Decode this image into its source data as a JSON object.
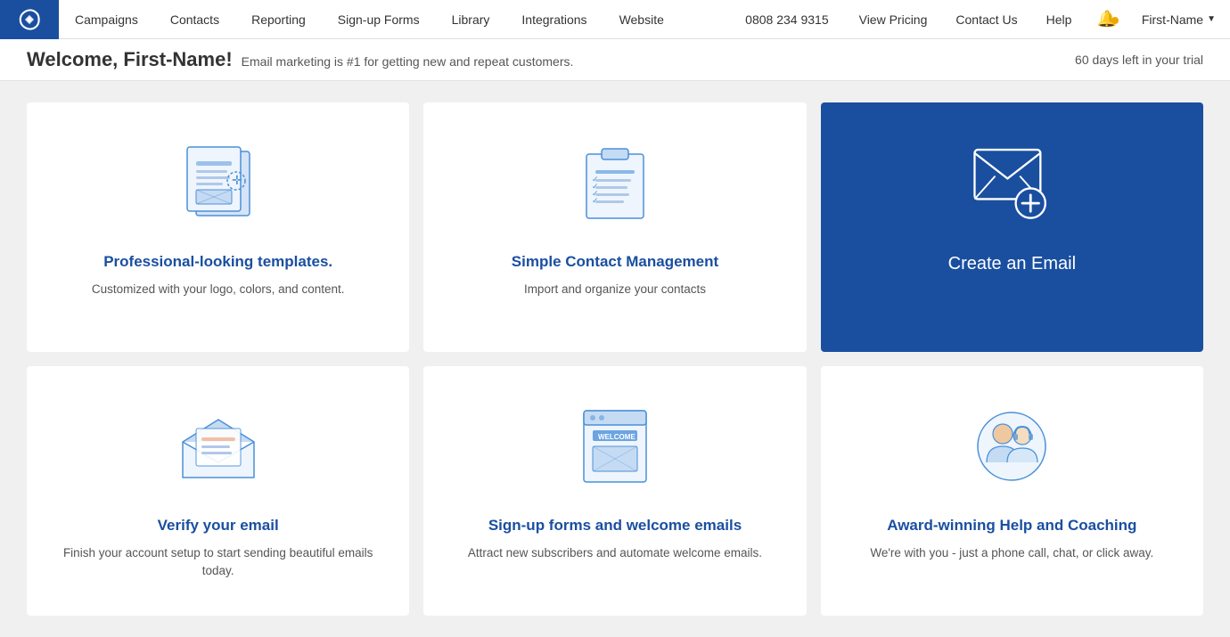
{
  "nav": {
    "logo_alt": "Campaigner logo",
    "links": [
      {
        "label": "Campaigns",
        "id": "campaigns"
      },
      {
        "label": "Contacts",
        "id": "contacts"
      },
      {
        "label": "Reporting",
        "id": "reporting"
      },
      {
        "label": "Sign-up Forms",
        "id": "signup-forms"
      },
      {
        "label": "Library",
        "id": "library"
      },
      {
        "label": "Integrations",
        "id": "integrations"
      },
      {
        "label": "Website",
        "id": "website"
      }
    ],
    "phone": "0808 234 9315",
    "view_pricing": "View Pricing",
    "contact_us": "Contact Us",
    "help": "Help",
    "user_name": "First-Name"
  },
  "trial": {
    "welcome": "Welcome, First-Name!",
    "sub": "Email marketing is #1 for getting new and repeat customers.",
    "days_left": "60 days left in your trial"
  },
  "cards": [
    {
      "id": "templates",
      "title": "Professional-looking templates.",
      "desc": "Customized with your logo, colors, and content.",
      "icon": "templates-icon"
    },
    {
      "id": "contacts",
      "title": "Simple Contact Management",
      "desc": "Import and organize your contacts",
      "icon": "contacts-icon"
    },
    {
      "id": "create-email",
      "title": "Create an Email",
      "desc": "",
      "icon": "create-email-icon",
      "blue": true
    },
    {
      "id": "verify-email",
      "title": "Verify your email",
      "desc": "Finish your account setup to start sending beautiful emails today.",
      "icon": "verify-email-icon"
    },
    {
      "id": "signup-forms",
      "title": "Sign-up forms and welcome emails",
      "desc": "Attract new subscribers and automate welcome emails.",
      "icon": "signup-forms-icon"
    },
    {
      "id": "help-coaching",
      "title": "Award-winning Help and Coaching",
      "desc": "We're with you - just a phone call, chat, or click away.",
      "icon": "help-coaching-icon"
    }
  ]
}
